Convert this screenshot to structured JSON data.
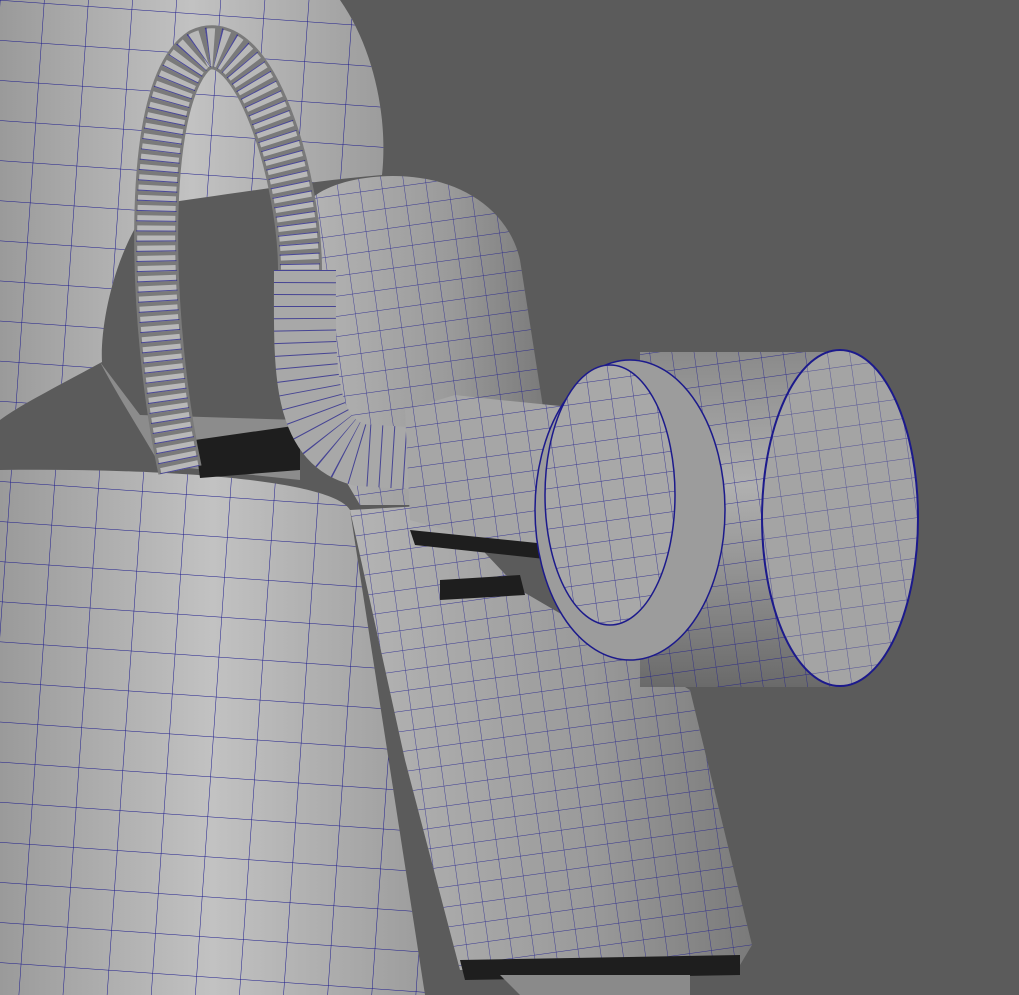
{
  "viewport": {
    "background_color": "#5b5b5b",
    "model_color_light": "#c4c4c4",
    "model_color_mid": "#9e9e9e",
    "model_color_dark": "#5e5e5e",
    "wireframe_color": "#1c1a8c",
    "shadow_color": "#1e1e1e"
  }
}
